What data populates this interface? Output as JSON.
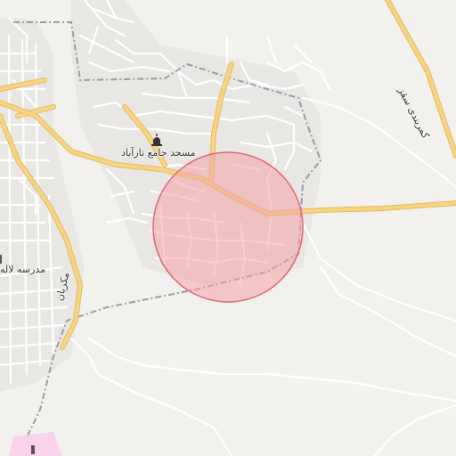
{
  "map": {
    "labels": {
      "mosque": "مسجد جامع تازآباد",
      "school": "مدرسه لاله",
      "road_left": "مکریان",
      "road_right": "کمربندی سقز"
    },
    "icons": {
      "mosque": "mosque-icon",
      "school": "school-icon",
      "poi": "poi-icon"
    },
    "colors": {
      "background": "#f3f1ee",
      "urban_area": "#e9e7e4",
      "minor_road": "#ffffff",
      "major_road": "#f7d480",
      "major_road_casing": "#e4b868",
      "boundary": "#9a9aa6",
      "highlight_fill": "#f4a3a8",
      "highlight_stroke": "#e06870",
      "pink_area": "#f8d3ea"
    }
  }
}
